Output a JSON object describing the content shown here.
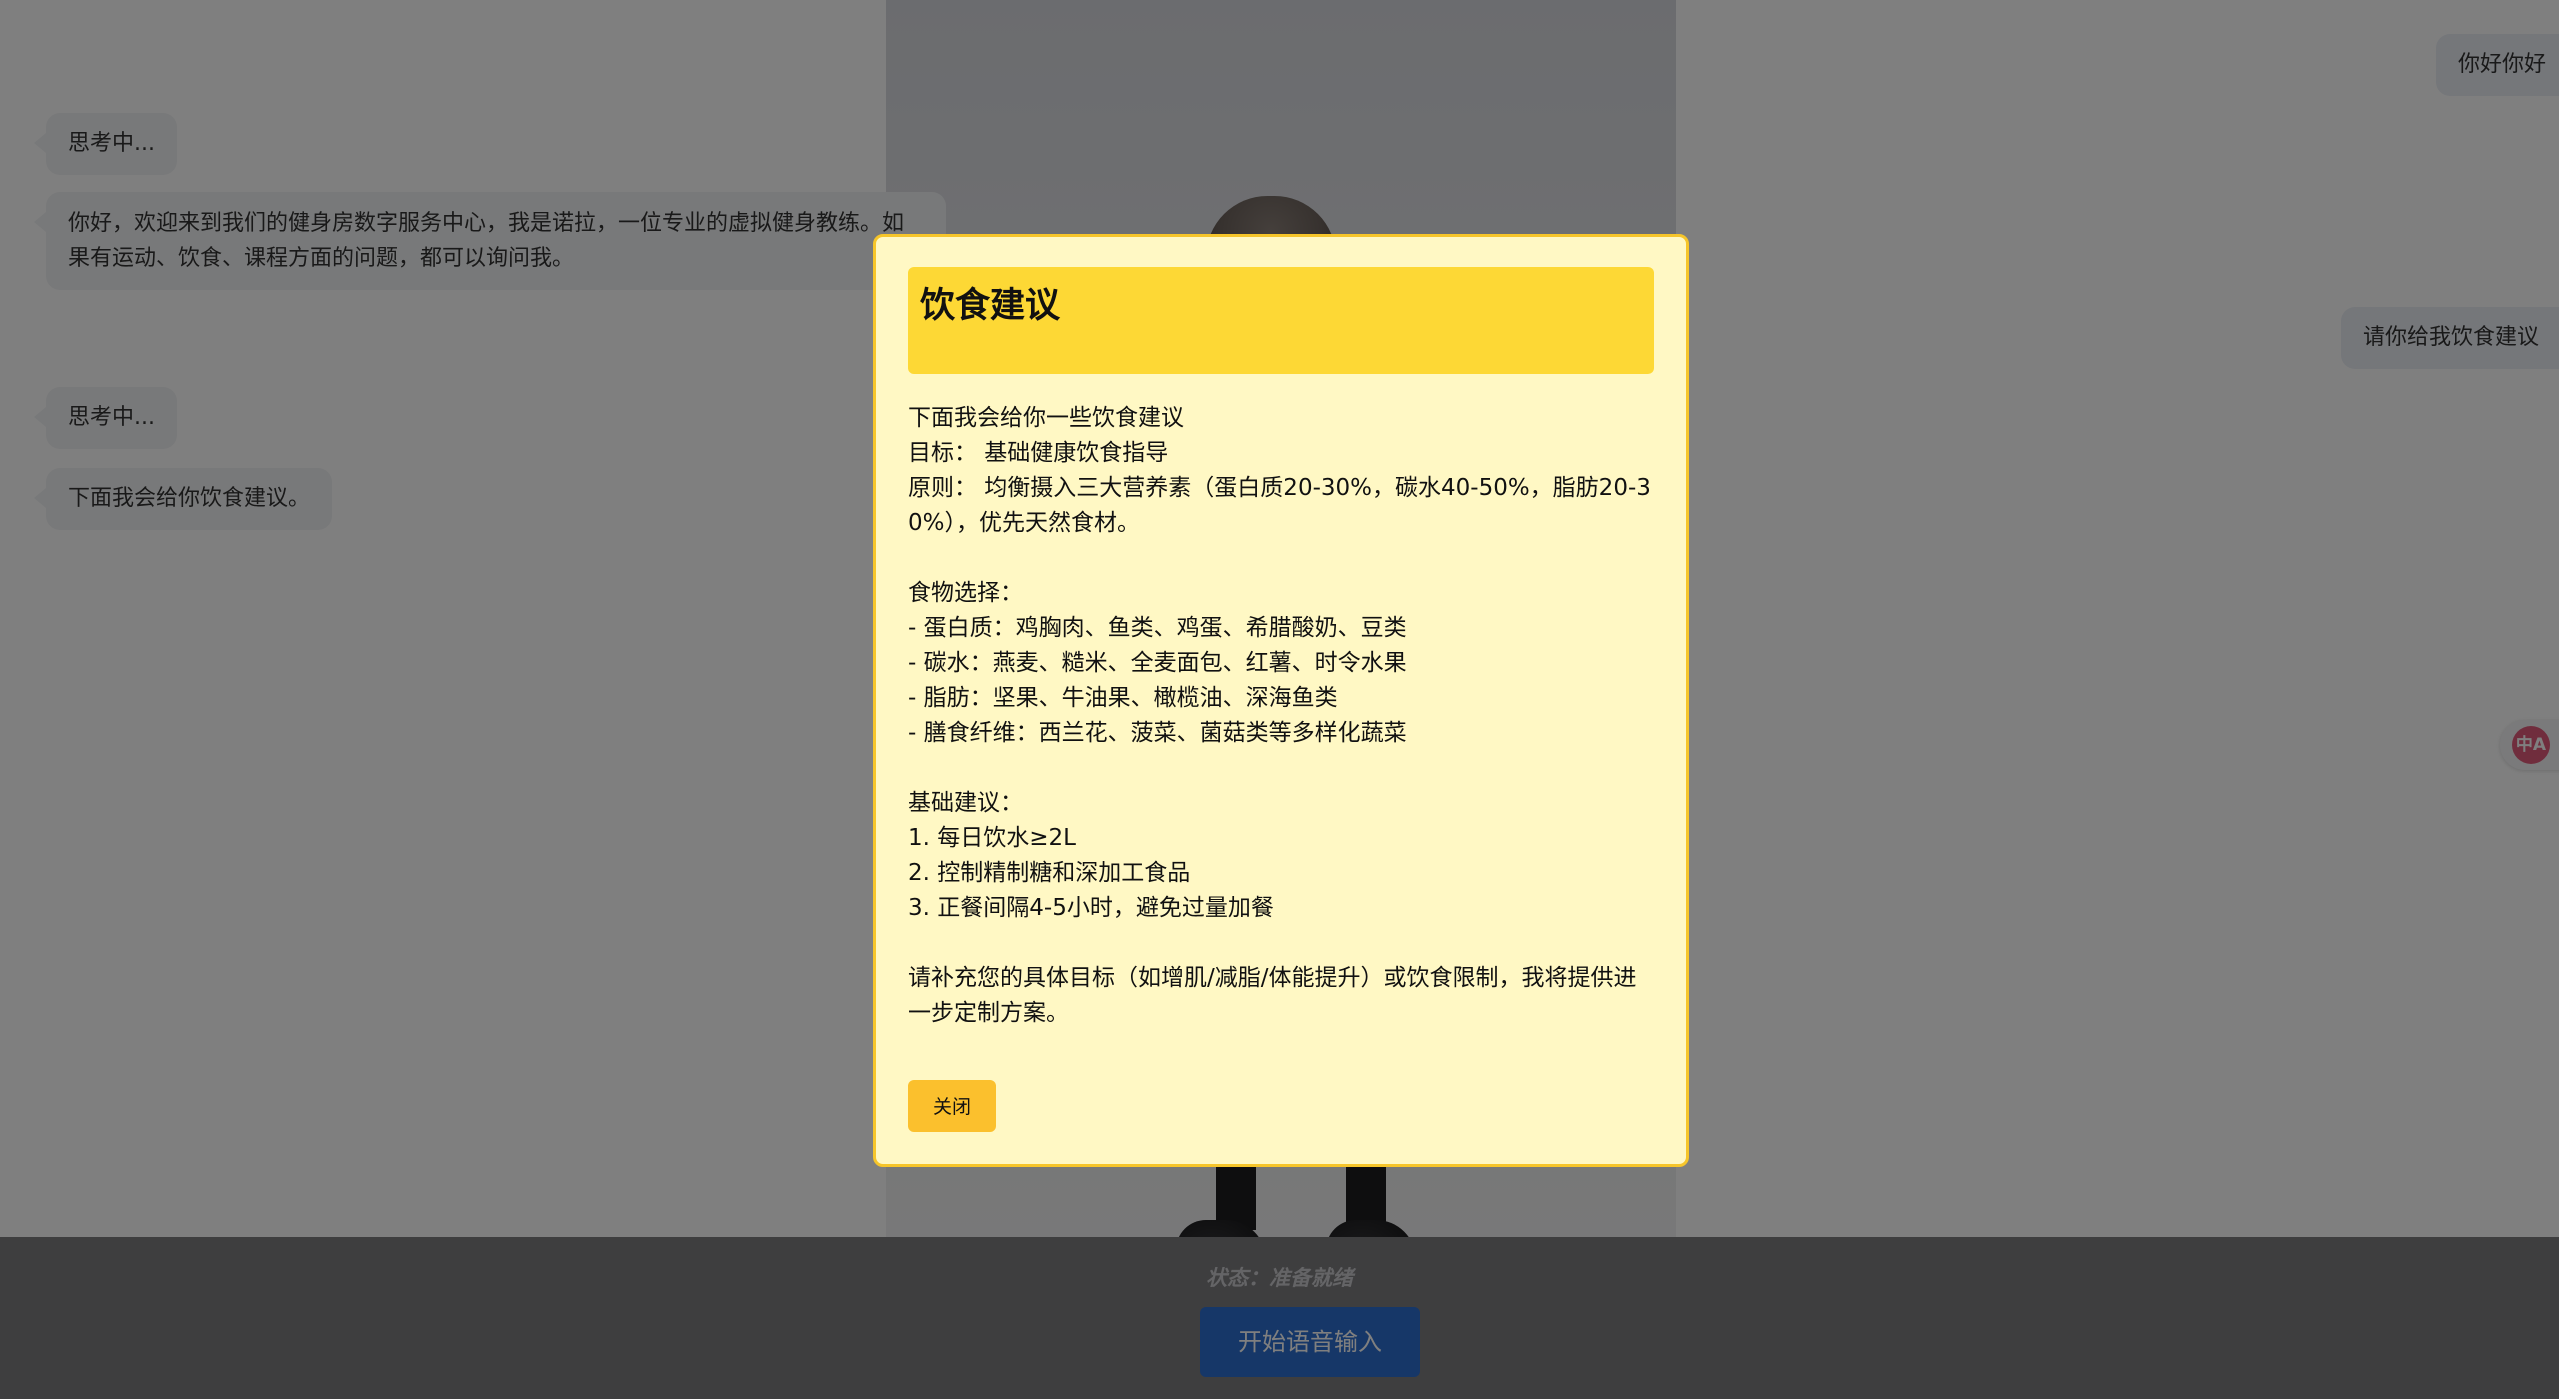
{
  "chat": {
    "messages": [
      {
        "role": "assistant",
        "text": "思考中..."
      },
      {
        "role": "assistant",
        "text": "你好，欢迎来到我们的健身房数字服务中心，我是诺拉，一位专业的虚拟健身教练。如果有运动、饮食、课程方面的问题，都可以询问我。"
      },
      {
        "role": "assistant",
        "text": "思考中..."
      },
      {
        "role": "assistant",
        "text": "下面我会给你饮食建议。"
      },
      {
        "role": "user",
        "text": "你好你好"
      },
      {
        "role": "user",
        "text": "请你给我饮食建议"
      }
    ]
  },
  "translate": {
    "icon": "translate-icon",
    "glyph": "中A"
  },
  "footer": {
    "status": "状态：准备就绪",
    "voice_button": "开始语音输入"
  },
  "modal": {
    "title": "饮食建议",
    "body": "下面我会给你一些饮食建议\n目标： 基础健康饮食指导\n原则： 均衡摄入三大营养素（蛋白质20-30%，碳水40-50%，脂肪20-30%），优先天然食材。\n\n食物选择：\n- 蛋白质：鸡胸肉、鱼类、鸡蛋、希腊酸奶、豆类\n- 碳水：燕麦、糙米、全麦面包、红薯、时令水果\n- 脂肪：坚果、牛油果、橄榄油、深海鱼类\n- 膳食纤维：西兰花、菠菜、菌菇类等多样化蔬菜\n\n基础建议：\n1. 每日饮水≥2L\n2. 控制精制糖和深加工食品\n3. 正餐间隔4-5小时，避免过量加餐\n\n请补充您的具体目标（如增肌/减脂/体能提升）或饮食限制，我将提供进一步定制方案。",
    "close_label": "关闭"
  },
  "colors": {
    "modal_bg": "#fff8c4",
    "modal_header": "#fdd835",
    "close_button": "#fbc02d",
    "voice_button": "#2d6fd1"
  }
}
